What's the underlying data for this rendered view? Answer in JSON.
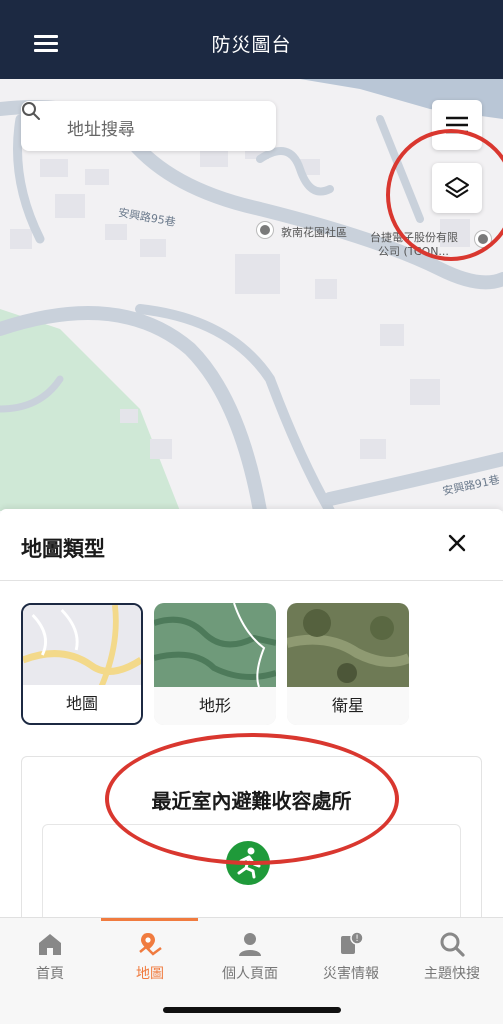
{
  "header": {
    "title": "防災圖台",
    "menu_icon": "hamburger-menu-icon"
  },
  "map": {
    "search_placeholder": "地址搜尋",
    "labels": {
      "road_1": "安興路95巷",
      "poi_1": "敦南花園社區",
      "poi_2_line1": "台捷電子股份有限",
      "poi_2_line2": "公司 (TCON...",
      "road_2": "安興路91巷"
    },
    "buttons": {
      "menu_icon": "list-menu-icon",
      "layers_icon": "layers-icon"
    },
    "colors": {
      "land": "#f2f1f3",
      "road": "#c9d1db",
      "green": "#cfe8d6",
      "water": "#b9c6d6",
      "highlight": "#d9372f"
    }
  },
  "sheet": {
    "title": "地圖類型",
    "close_icon": "close-icon",
    "map_types": [
      {
        "label": "地圖",
        "selected": true
      },
      {
        "label": "地形",
        "selected": false
      },
      {
        "label": "衛星",
        "selected": false
      }
    ],
    "shelter_title": "最近室內避難收容處所",
    "shelter_icon": "emergency-exit-icon"
  },
  "nav": {
    "items": [
      {
        "label": "首頁",
        "icon": "home-icon",
        "active": false
      },
      {
        "label": "地圖",
        "icon": "map-pin-icon",
        "active": true
      },
      {
        "label": "個人頁面",
        "icon": "person-icon",
        "active": false
      },
      {
        "label": "災害情報",
        "icon": "alert-icon",
        "active": false
      },
      {
        "label": "主題快搜",
        "icon": "search-icon",
        "active": false
      }
    ],
    "accent": "#f07b3f"
  }
}
